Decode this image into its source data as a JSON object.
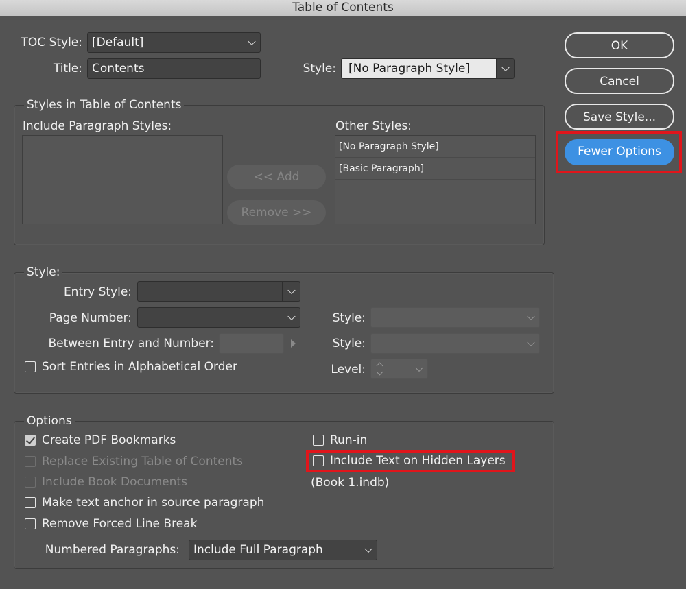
{
  "window": {
    "title": "Table of Contents"
  },
  "top": {
    "toc_style_label": "TOC Style:",
    "toc_style_value": "[Default]",
    "title_label": "Title:",
    "title_value": "Contents",
    "style_label": "Style:",
    "style_value": "[No Paragraph Style]"
  },
  "styles_group": {
    "title": "Styles in Table of Contents",
    "include_label": "Include Paragraph Styles:",
    "include_items": [],
    "add_label": "<< Add",
    "remove_label": "Remove >>",
    "other_label": "Other Styles:",
    "other_items": [
      "[No Paragraph Style]",
      "[Basic Paragraph]"
    ]
  },
  "style_group": {
    "title": "Style:",
    "entry_style_label": "Entry Style:",
    "entry_style_value": "",
    "page_number_label": "Page Number:",
    "page_number_value": "",
    "between_label": "Between Entry and Number:",
    "between_value": "",
    "style1_label": "Style:",
    "style2_label": "Style:",
    "sort_label": "Sort Entries in Alphabetical Order",
    "sort_checked": false,
    "level_label": "Level:"
  },
  "options_group": {
    "title": "Options",
    "pdf_bookmarks": {
      "label": "Create PDF Bookmarks",
      "checked": true
    },
    "replace_existing": {
      "label": "Replace Existing Table of Contents",
      "checked": false,
      "disabled": true
    },
    "include_book": {
      "label": "Include Book Documents",
      "checked": false,
      "disabled": true
    },
    "text_anchor": {
      "label": "Make text anchor in source paragraph",
      "checked": false
    },
    "remove_break": {
      "label": "Remove Forced Line Break",
      "checked": false
    },
    "run_in": {
      "label": "Run-in",
      "checked": false
    },
    "hidden_layers": {
      "label": "Include Text on Hidden Layers",
      "checked": false
    },
    "book_name": "(Book 1.indb)",
    "numbered_label": "Numbered Paragraphs:",
    "numbered_value": "Include Full Paragraph"
  },
  "buttons": {
    "ok": "OK",
    "cancel": "Cancel",
    "save_style": "Save Style...",
    "fewer_options": "Fewer Options"
  },
  "colors": {
    "background": "#535353",
    "accent_blue": "#3d91e3",
    "highlight_red": "#e0151b"
  }
}
